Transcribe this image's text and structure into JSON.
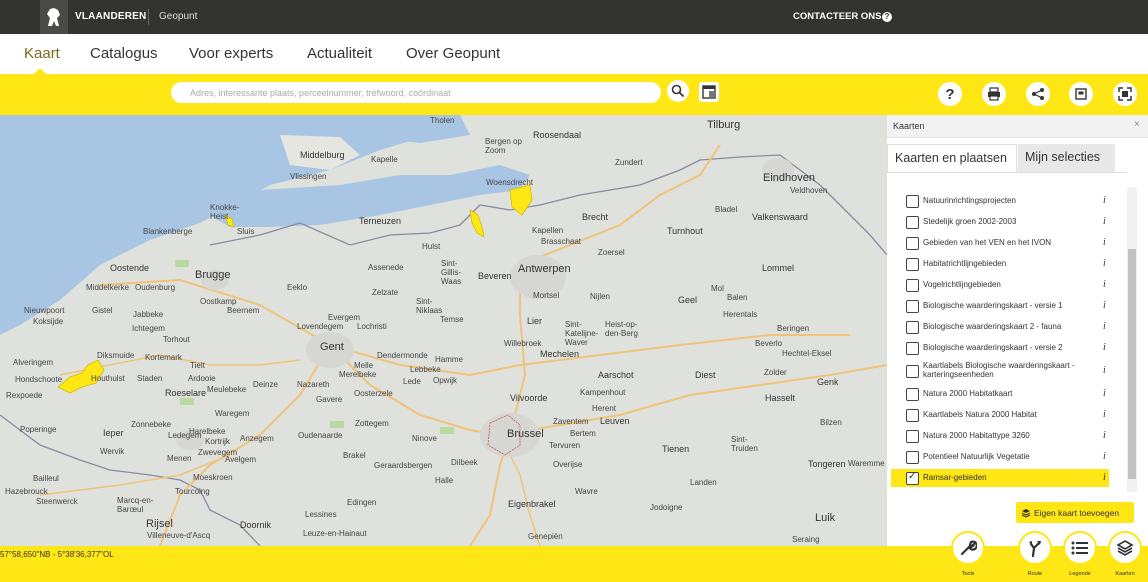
{
  "header": {
    "brand": "VLAANDEREN",
    "product": "Geopunt",
    "contact": "CONTACTEER ONS",
    "help": "?"
  },
  "nav": {
    "items": [
      "Kaart",
      "Catalogus",
      "Voor experts",
      "Actualiteit",
      "Over Geopunt"
    ],
    "active": "Kaart"
  },
  "search": {
    "placeholder": "Adres, interessante plaats, perceelnummer, trefwoord, coördinaat"
  },
  "toolbar": {
    "icons": [
      "search-icon",
      "layers-select-icon",
      "help-icon",
      "print-icon",
      "share-icon",
      "frame-icon",
      "fullscreen-icon"
    ]
  },
  "map": {
    "places": [
      "Tholen",
      "Roosendaal",
      "Tilburg",
      "Middelburg",
      "Bergen op Zoom",
      "Zundert",
      "Kapelle",
      "Vlissingen",
      "Woensdrecht",
      "Eindhoven",
      "Veldhoven",
      "Knokke-Heist",
      "Terneuzen",
      "Brecht",
      "Bladel",
      "Valkenswaard",
      "Sluis",
      "Blankenberge",
      "Hulst",
      "Kapellen",
      "Turnhout",
      "Brasschaat",
      "Oostende",
      "Brugge",
      "Assenede",
      "Sint-Gillis-Waas",
      "Beveren",
      "Antwerpen",
      "Zoersel",
      "Lommel",
      "Middelkerke",
      "Oudenburg",
      "Eeklo",
      "Mortsel",
      "Mol",
      "Nieuwpoort",
      "Gistel",
      "Oostkamp",
      "Zelzate",
      "Sint-Niklaas",
      "Nijlen",
      "Geel",
      "Balen",
      "Koksijde",
      "Jabbeke",
      "Beernem",
      "Evergem",
      "Temse",
      "Lier",
      "Herentals",
      "Ichtegem",
      "Lovendegem",
      "Lochristi",
      "Sint-Katelijne-Waver",
      "Heist-op-den-Berg",
      "Diksmuide",
      "Torhout",
      "Gent",
      "Dendermonde",
      "Willebroek",
      "Mechelen",
      "Beringen",
      "Alveringem",
      "Kortemark",
      "Tielt",
      "Melle",
      "Hamme",
      "Beverlo",
      "Hechtel-Eksel",
      "Houthulst",
      "Staden",
      "Ardooie",
      "Deinze",
      "Merelbeke",
      "Lebbeke",
      "Aarschot",
      "Diest",
      "Zolder",
      "Hondschoote",
      "Roeselare",
      "Meulebeke",
      "Nazareth",
      "Lede",
      "Opwijk",
      "Kampenhout",
      "Genk",
      "Rexpoede",
      "Waregem",
      "Gavere",
      "Oosterzele",
      "Vilvoorde",
      "Herent",
      "Leuven",
      "Hasselt",
      "Bilzen",
      "Zonnebeke",
      "Harelbeke",
      "Zottegem",
      "Anzegem",
      "Zaventem",
      "Bertem",
      "Tienen",
      "Sint-Truiden",
      "Tongeren",
      "Poperinge",
      "Ieper",
      "Kortrijk",
      "Oudenaarde",
      "Ninove",
      "Brussel",
      "Tervuren",
      "Ledegem",
      "Zwevegem",
      "Wervik",
      "Menen",
      "Avelgem",
      "Brakel",
      "Geraardsbergen",
      "Dilbeek",
      "Overijse",
      "Waremme",
      "Bailleul",
      "Moeskroen",
      "Halle",
      "Wavre",
      "Landen",
      "Hazebrouck",
      "Steenwerck",
      "Tourcoing",
      "Rijsel",
      "Edingen",
      "Eigenbrakel",
      "Marcq-en-Barœul",
      "Lessines",
      "Jodoigne",
      "Luik",
      "Villeneuve-d'Ascq",
      "Doornik",
      "Leuze-en-Hainaut",
      "Genepiën",
      "Seraing"
    ]
  },
  "coordinates": "57°58,650\"NB - 5°38'36,377\"OL",
  "panel": {
    "title": "Kaarten",
    "close": "×",
    "tabs": [
      "Kaarten en plaatsen",
      "Mijn selecties"
    ],
    "layers": [
      {
        "label": "Natuurinrichtingsprojecten",
        "checked": false
      },
      {
        "label": "Stedelijk groen 2002-2003",
        "checked": false
      },
      {
        "label": "Gebieden van het VEN en het IVON",
        "checked": false
      },
      {
        "label": "Habitatrichtlijngebieden",
        "checked": false
      },
      {
        "label": "Vogelrichtlijngebieden",
        "checked": false
      },
      {
        "label": "Biologische waarderingskaart - versie 1",
        "checked": false
      },
      {
        "label": "Biologische waarderingskaart 2 - fauna",
        "checked": false
      },
      {
        "label": "Biologische waarderingskaart - versie 2",
        "checked": false
      },
      {
        "label": "Kaartlabels Biologische waarderingskaart - karteringseenheden",
        "checked": false
      },
      {
        "label": "Natura 2000 Habitatkaart",
        "checked": false
      },
      {
        "label": "Kaartlabels Natura 2000 Habitat",
        "checked": false
      },
      {
        "label": "Natura 2000 Habitattype 3260",
        "checked": false
      },
      {
        "label": "Potentieel Natuurlijk Vegetatie",
        "checked": false
      },
      {
        "label": "Ramsar-gebieden",
        "checked": true
      }
    ],
    "info": "i",
    "add_button": "Eigen kaart toevoegen"
  },
  "tools": [
    {
      "label": "Tools",
      "icon": "wrench-icon"
    },
    {
      "label": "Route",
      "icon": "route-icon"
    },
    {
      "label": "Legende",
      "icon": "legend-icon"
    },
    {
      "label": "Kaarten",
      "icon": "layers-icon"
    }
  ],
  "colors": {
    "accent": "#ffe615",
    "header": "#333332",
    "water": "#a8c6e4",
    "land": "#dfe2dc"
  }
}
